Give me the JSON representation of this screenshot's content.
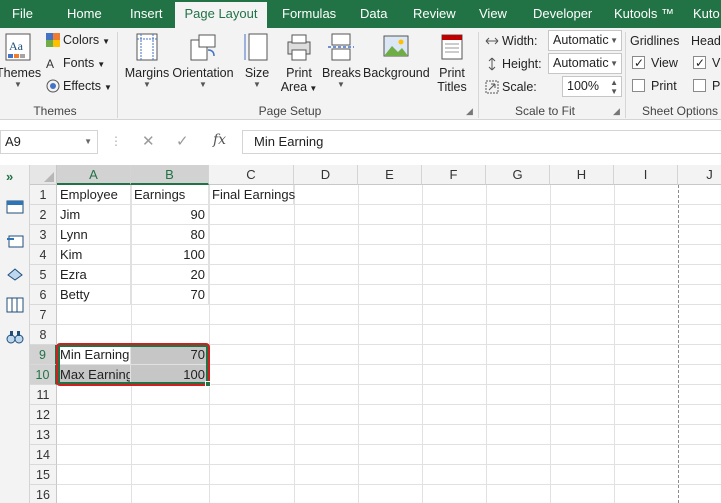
{
  "ribbon_tabs": [
    "File",
    "Home",
    "Insert",
    "Page Layout",
    "Formulas",
    "Data",
    "Review",
    "View",
    "Developer",
    "Kutools ™",
    "Kuto"
  ],
  "themes_group": {
    "themes_label": "Themes",
    "colors_label": "Colors",
    "fonts_label": "Fonts",
    "effects_label": "Effects",
    "group_label": "Themes"
  },
  "page_setup_group": {
    "margins_label": "Margins",
    "orientation_label": "Orientation",
    "size_label": "Size",
    "print_area_label_1": "Print",
    "print_area_label_2": "Area",
    "breaks_label": "Breaks",
    "background_label": "Background",
    "print_titles_label_1": "Print",
    "print_titles_label_2": "Titles",
    "group_label": "Page Setup"
  },
  "scale_group": {
    "width_label": "Width:",
    "width_value": "Automatic",
    "height_label": "Height:",
    "height_value": "Automatic",
    "scale_label": "Scale:",
    "scale_value": "100%",
    "group_label": "Scale to Fit"
  },
  "sheet_options_group": {
    "gridlines_label": "Gridlines",
    "headings_label": "Head",
    "view_label": "View",
    "print_label": "Print",
    "view_checked": true,
    "print_checked": false,
    "headings_view_label": "V",
    "headings_print_label": "P",
    "group_label": "Sheet Options"
  },
  "formula_bar": {
    "name_box": "A9",
    "fx_label": "fx",
    "formula": "Min Earning"
  },
  "columns": [
    "A",
    "B",
    "C",
    "D",
    "E",
    "F",
    "G",
    "H",
    "I",
    "J"
  ],
  "rows": [
    "1",
    "2",
    "3",
    "4",
    "5",
    "6",
    "7",
    "8",
    "9",
    "10",
    "11",
    "12",
    "13",
    "14",
    "15",
    "16"
  ],
  "cells": {
    "A1": "Employee",
    "B1": "Earnings",
    "C1": "Final Earnings",
    "A2": "Jim",
    "B2": "90",
    "A3": "Lynn",
    "B3": "80",
    "A4": "Kim",
    "B4": "100",
    "A5": "Ezra",
    "B5": "20",
    "A6": "Betty",
    "B6": "70",
    "A9": "Min Earning",
    "B9": "70",
    "A10": "Max Earning",
    "B10": "100"
  },
  "colors": {
    "excel_green": "#217346",
    "highlight_red": "#d11f1f",
    "selection_gray": "#c6c6c6"
  }
}
